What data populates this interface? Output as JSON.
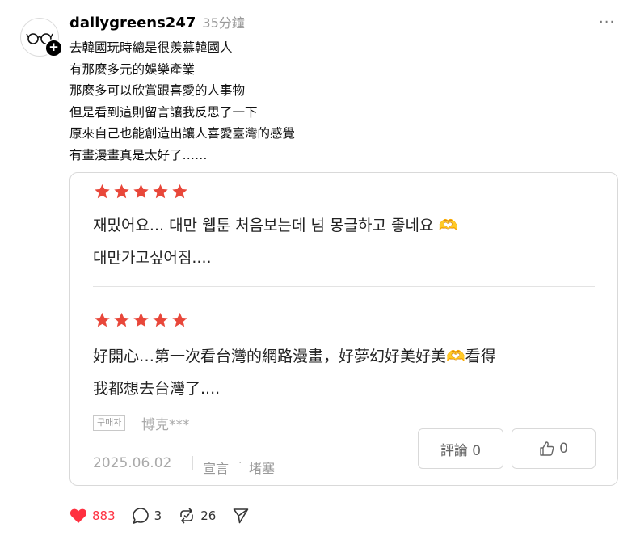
{
  "post": {
    "username": "dailygreens247",
    "timestamp": "35分鐘",
    "lines": [
      "去韓國玩時總是很羨慕韓國人",
      "有那麼多元的娛樂產業",
      "那麼多可以欣賞跟喜愛的人事物",
      "但是看到這則留言讓我反思了一下",
      "原來自己也能創造出讓人喜愛臺灣的感覺",
      "有畫漫畫真是太好了……"
    ]
  },
  "card": {
    "review1": {
      "rating": 5,
      "line1": "재밌어요... 대만 웹툰 처음보는데 넘 몽글하고 좋네요 🫶",
      "line2": "대만가고싶어짐...."
    },
    "review2": {
      "rating": 5,
      "line1": "好開心…第一次看台灣的網路漫畫，好夢幻好美好美🫶看得",
      "line2": "我都想去台灣了...."
    },
    "badge": "구매자",
    "reviewer": "博克***",
    "date": "2025.06.02",
    "declare": "宣言",
    "block": "堵塞",
    "comment_button": "評論 0",
    "like_button": "0"
  },
  "actions": {
    "likes": "883",
    "comments": "3",
    "reposts": "26"
  },
  "colors": {
    "star": "#e8473a",
    "like": "#ff3040"
  }
}
